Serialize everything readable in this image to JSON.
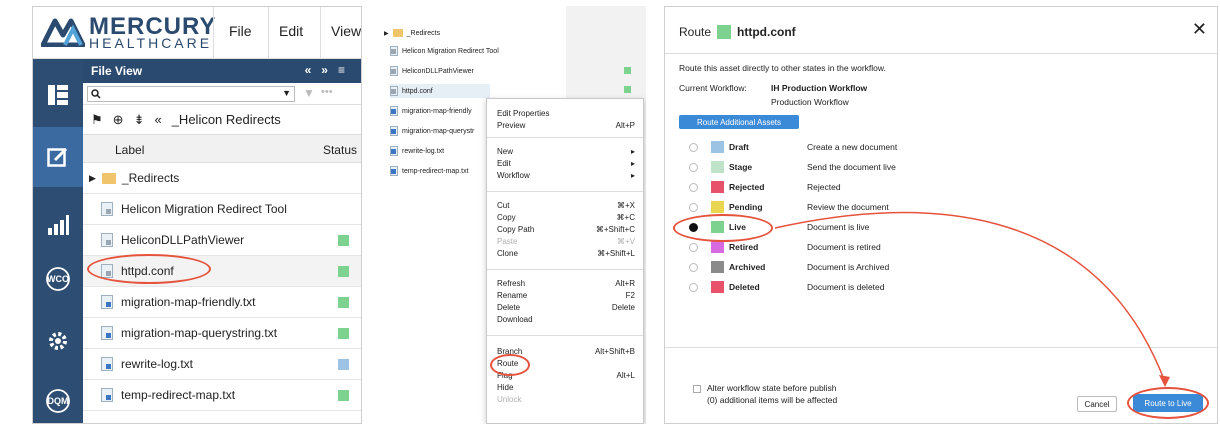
{
  "colors": {
    "green_status": "#7ed28f",
    "blue_status": "#9cc2e4",
    "navy": "#2b4a6f",
    "accent_blue": "#3b8ad8",
    "annotation_red": "#e5533d"
  },
  "panel1": {
    "logo": {
      "name": "MERCURY",
      "sub": "HEALTHCARE"
    },
    "menu": [
      "File",
      "Edit",
      "View"
    ],
    "sidebar_icons": [
      "file-view-icon",
      "edit-icon",
      "analytics-icon",
      "wco-icon",
      "settings-icon",
      "dqm-icon"
    ],
    "sidebar_labels": {
      "wco": "WCO",
      "dqm": "DQM"
    },
    "file_view_title": "File View",
    "header_controls": [
      "«",
      "»",
      "≡"
    ],
    "breadcrumb": "_Helicon Redirects",
    "col_label": "Label",
    "col_status": "Status",
    "rows": [
      {
        "label": "_Redirects",
        "kind": "folder",
        "status": ""
      },
      {
        "label": "Helicon Migration Redirect Tool",
        "kind": "gray",
        "status": ""
      },
      {
        "label": "HeliconDLLPathViewer",
        "kind": "gray",
        "status": "green"
      },
      {
        "label": "httpd.conf",
        "kind": "gray",
        "status": "green"
      },
      {
        "label": "migration-map-friendly.txt",
        "kind": "file",
        "status": "green"
      },
      {
        "label": "migration-map-querystring.txt",
        "kind": "file",
        "status": "green"
      },
      {
        "label": "rewrite-log.txt",
        "kind": "file",
        "status": "blue"
      },
      {
        "label": "temp-redirect-map.txt",
        "kind": "file",
        "status": "green"
      }
    ]
  },
  "panel2": {
    "rows": [
      "_Redirects",
      "Helicon Migration Redirect Tool",
      "HeliconDLLPathViewer",
      "httpd.conf",
      "migration-map-friendly",
      "migration-map-querystr",
      "rewrite-log.txt",
      "temp-redirect-map.txt"
    ],
    "menu": [
      {
        "label": "Edit Properties",
        "shortcut": ""
      },
      {
        "label": "Preview",
        "shortcut": "Alt+P"
      },
      {
        "label": "New",
        "shortcut": "▸"
      },
      {
        "label": "Edit",
        "shortcut": "▸"
      },
      {
        "label": "Workflow",
        "shortcut": "▸"
      },
      {
        "label": "Cut",
        "shortcut": "⌘+X"
      },
      {
        "label": "Copy",
        "shortcut": "⌘+C"
      },
      {
        "label": "Copy Path",
        "shortcut": "⌘+Shift+C"
      },
      {
        "label": "Paste",
        "shortcut": "⌘+V",
        "disabled": true
      },
      {
        "label": "Clone",
        "shortcut": "⌘+Shift+L"
      },
      {
        "label": "Refresh",
        "shortcut": "Alt+R"
      },
      {
        "label": "Rename",
        "shortcut": "F2"
      },
      {
        "label": "Delete",
        "shortcut": "Delete"
      },
      {
        "label": "Download",
        "shortcut": ""
      },
      {
        "label": "Branch",
        "shortcut": "Alt+Shift+B"
      },
      {
        "label": "Route",
        "shortcut": ""
      },
      {
        "label": "Flag",
        "shortcut": "Alt+L"
      },
      {
        "label": "Hide",
        "shortcut": ""
      },
      {
        "label": "Unlock",
        "shortcut": "",
        "disabled": true
      }
    ]
  },
  "panel3": {
    "title_prefix": "Route",
    "title_file": "httpd.conf",
    "intro": "Route this asset directly to other states in the workflow.",
    "workflow_label": "Current Workflow:",
    "workflow_name": "IH Production Workflow",
    "workflow_sub": "Production Workflow",
    "assets_button": "Route Additional Assets",
    "states": [
      {
        "name": "Draft",
        "desc": "Create a new document",
        "color": "#9cc2e4",
        "selected": false
      },
      {
        "name": "Stage",
        "desc": "Send the document live",
        "color": "#bfe3c8",
        "selected": false
      },
      {
        "name": "Rejected",
        "desc": "Rejected",
        "color": "#e8516a",
        "selected": false
      },
      {
        "name": "Pending",
        "desc": "Review the document",
        "color": "#e9d54f",
        "selected": false
      },
      {
        "name": "Live",
        "desc": "Document is live",
        "color": "#7ed28f",
        "selected": true
      },
      {
        "name": "Retired",
        "desc": "Document is retired",
        "color": "#d86ae0",
        "selected": false
      },
      {
        "name": "Archived",
        "desc": "Document is Archived",
        "color": "#8a8a8a",
        "selected": false
      },
      {
        "name": "Deleted",
        "desc": "Document is deleted",
        "color": "#e8516a",
        "selected": false
      }
    ],
    "alter_label": "Alter workflow state before publish",
    "alter_note": "(0) additional items will be affected",
    "cancel": "Cancel",
    "route_button": "Route to Live",
    "close": "✕"
  }
}
